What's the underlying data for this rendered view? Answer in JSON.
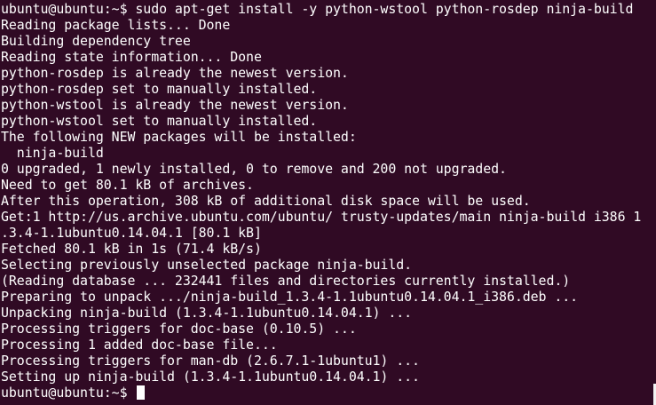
{
  "terminal": {
    "lines": [
      "ubuntu@ubuntu:~$ sudo apt-get install -y python-wstool python-rosdep ninja-build",
      "Reading package lists... Done",
      "Building dependency tree",
      "Reading state information... Done",
      "python-rosdep is already the newest version.",
      "python-rosdep set to manually installed.",
      "python-wstool is already the newest version.",
      "python-wstool set to manually installed.",
      "The following NEW packages will be installed:",
      "  ninja-build",
      "0 upgraded, 1 newly installed, 0 to remove and 200 not upgraded.",
      "Need to get 80.1 kB of archives.",
      "After this operation, 308 kB of additional disk space will be used.",
      "Get:1 http://us.archive.ubuntu.com/ubuntu/ trusty-updates/main ninja-build i386 1",
      ".3.4-1.1ubuntu0.14.04.1 [80.1 kB]",
      "Fetched 80.1 kB in 1s (71.4 kB/s)",
      "Selecting previously unselected package ninja-build.",
      "(Reading database ... 232441 files and directories currently installed.)",
      "Preparing to unpack .../ninja-build_1.3.4-1.1ubuntu0.14.04.1_i386.deb ...",
      "Unpacking ninja-build (1.3.4-1.1ubuntu0.14.04.1) ...",
      "Processing triggers for doc-base (0.10.5) ...",
      "Processing 1 added doc-base file...",
      "Processing triggers for man-db (2.6.7.1-1ubuntu1) ...",
      "Setting up ninja-build (1.3.4-1.1ubuntu0.14.04.1) ..."
    ],
    "prompt": "ubuntu@ubuntu:~$ "
  }
}
